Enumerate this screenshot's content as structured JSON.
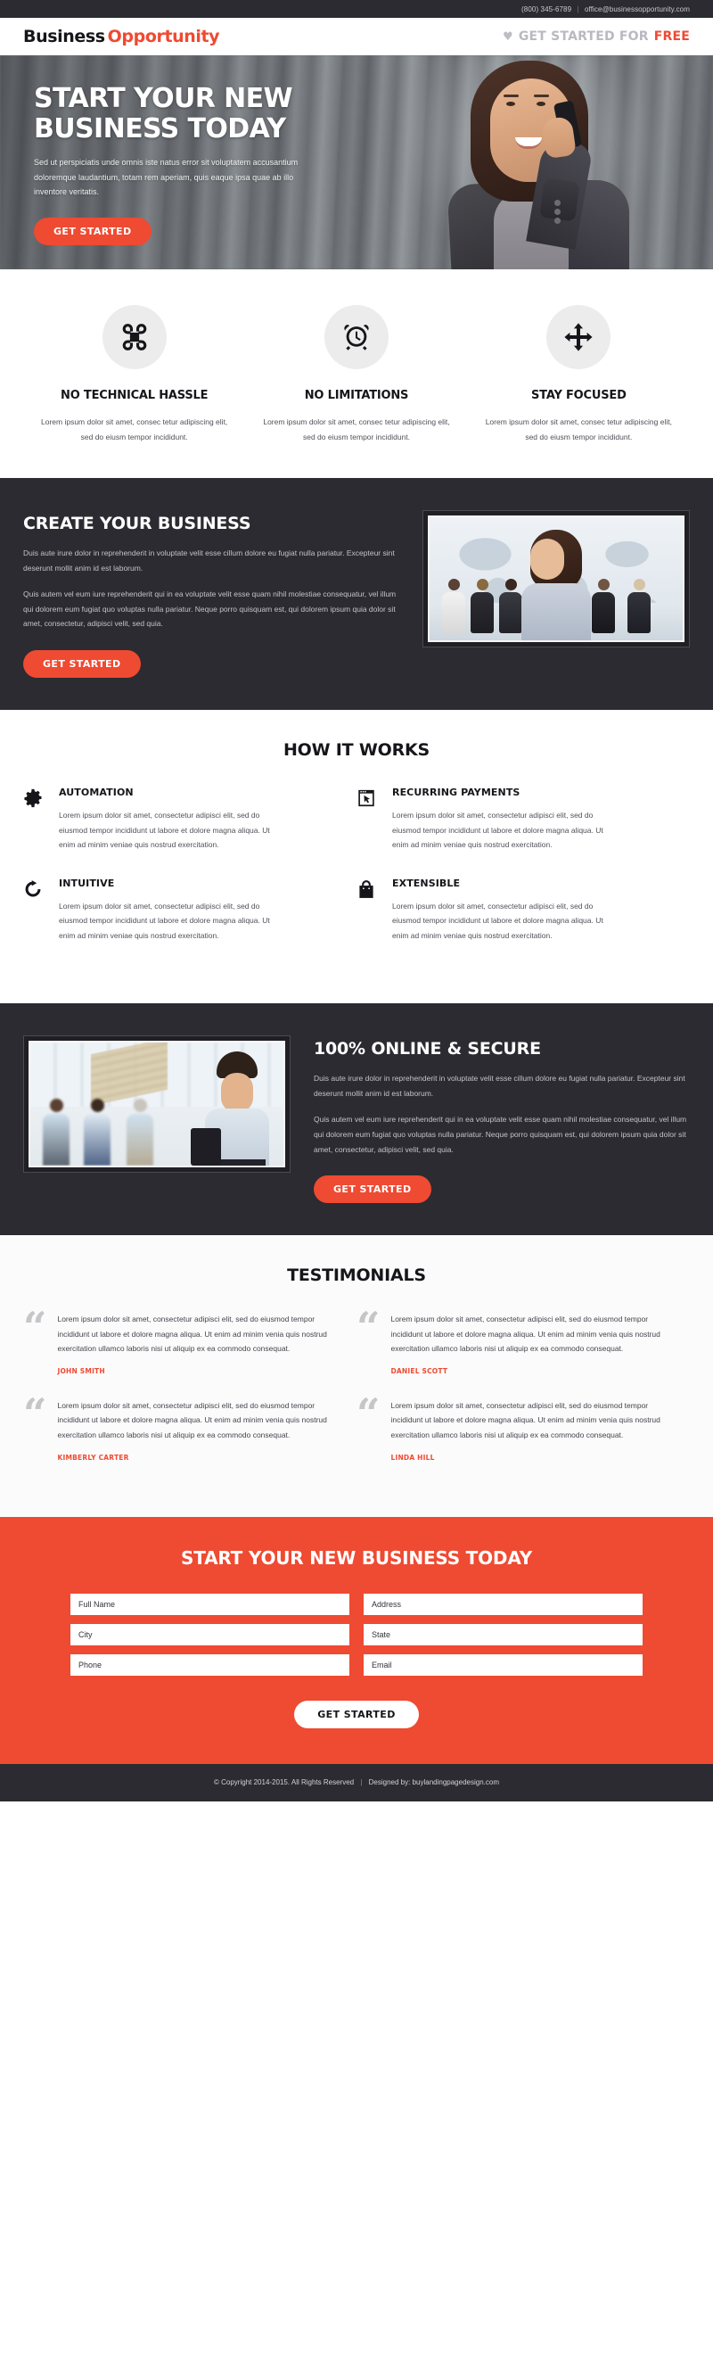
{
  "topbar": {
    "phone": "(800) 345-6789",
    "separator": "|",
    "email": "office@businessopportunity.com"
  },
  "header": {
    "logo_part1": "Business",
    "logo_part2": "Opportunity",
    "heart_icon": "heart-icon",
    "cta_grey": "GET STARTED FOR",
    "cta_accent": "FREE"
  },
  "hero": {
    "title_line1": "START YOUR NEW",
    "title_line2": "BUSINESS TODAY",
    "subtitle": "Sed ut perspiciatis unde omnis iste natus error sit voluptatem accusantium doloremque laudantium, totam rem aperiam, quis eaque ipsa quae ab illo inventore veritatis.",
    "button": "GET STARTED",
    "image_alt": "businesswoman-on-phone-photo"
  },
  "features": [
    {
      "icon": "command-icon",
      "title": "NO TECHNICAL HASSLE",
      "text": "Lorem ipsum dolor sit amet, consec tetur adipiscing elit, sed do eiusm tempor incididunt."
    },
    {
      "icon": "alarm-clock-icon",
      "title": "NO LIMITATIONS",
      "text": "Lorem ipsum dolor sit amet, consec tetur adipiscing elit, sed do eiusm tempor incididunt."
    },
    {
      "icon": "move-arrows-icon",
      "title": "STAY FOCUSED",
      "text": "Lorem ipsum dolor sit amet, consec tetur adipiscing elit, sed do eiusm tempor incididunt."
    }
  ],
  "create_business": {
    "title": "CREATE YOUR BUSINESS",
    "paragraph1": "Duis aute irure dolor in reprehenderit in voluptate velit esse cillum dolore eu fugiat nulla pariatur. Excepteur sint deserunt mollit anim id est laborum.",
    "paragraph2": "Quis autem vel eum iure reprehenderit qui in ea voluptate velit esse quam nihil molestiae consequatur, vel illum qui dolorem eum fugiat quo voluptas nulla pariatur. Neque porro quisquam est, qui dolorem ipsum quia dolor sit amet, consectetur, adipisci velit, sed quia.",
    "button": "GET STARTED",
    "image_alt": "business-team-world-map-photo"
  },
  "how_it_works": {
    "title": "HOW IT WORKS",
    "items": [
      {
        "icon": "gear-icon",
        "title": "AUTOMATION",
        "text": "Lorem ipsum dolor sit amet, consectetur adipisci elit, sed do eiusmod tempor incididunt ut labore et dolore magna aliqua. Ut enim ad minim veniae quis nostrud exercitation."
      },
      {
        "icon": "browser-cursor-icon",
        "title": "RECURRING PAYMENTS",
        "text": "Lorem ipsum dolor sit amet, consectetur adipisci elit, sed do eiusmod tempor incididunt ut labore et dolore magna aliqua. Ut enim ad minim veniae quis nostrud exercitation."
      },
      {
        "icon": "refresh-icon",
        "title": "INTUITIVE",
        "text": "Lorem ipsum dolor sit amet, consectetur adipisci elit, sed do eiusmod tempor incididunt ut labore et dolore magna aliqua. Ut enim ad minim veniae quis nostrud exercitation."
      },
      {
        "icon": "shopping-bag-icon",
        "title": "EXTENSIBLE",
        "text": "Lorem ipsum dolor sit amet, consectetur adipisci elit, sed do eiusmod tempor incididunt ut labore et dolore magna aliqua. Ut enim ad minim veniae quis nostrud exercitation."
      }
    ]
  },
  "online_secure": {
    "title": "100% ONLINE & SECURE",
    "paragraph1": "Duis aute irure dolor in reprehenderit in voluptate velit esse cillum dolore eu fugiat nulla pariatur. Excepteur sint deserunt mollit anim id est laborum.",
    "paragraph2": "Quis autem vel eum iure reprehenderit qui in ea voluptate velit esse quam nihil molestiae consequatur, vel illum qui dolorem eum fugiat quo voluptas nulla pariatur. Neque porro quisquam est, qui dolorem ipsum quia dolor sit amet, consectetur, adipisci velit, sed quia.",
    "button": "GET STARTED",
    "image_alt": "businessman-office-team-photo"
  },
  "testimonials": {
    "title": "TESTIMONIALS",
    "quote_glyph": "“",
    "items": [
      {
        "text": "Lorem ipsum dolor sit amet, consectetur adipisci elit, sed do eiusmod tempor incididunt ut labore et dolore magna aliqua. Ut enim ad minim venia quis nostrud exercitation ullamco laboris nisi ut aliquip ex ea commodo consequat.",
        "name": "JOHN SMITH"
      },
      {
        "text": "Lorem ipsum dolor sit amet, consectetur adipisci elit, sed do eiusmod tempor incididunt ut labore et dolore magna aliqua. Ut enim ad minim venia quis nostrud exercitation ullamco laboris nisi ut aliquip ex ea commodo consequat.",
        "name": "DANIEL SCOTT"
      },
      {
        "text": "Lorem ipsum dolor sit amet, consectetur adipisci elit, sed do eiusmod tempor incididunt ut labore et dolore magna aliqua. Ut enim ad minim venia quis nostrud exercitation ullamco laboris nisi ut aliquip ex ea commodo consequat.",
        "name": "KIMBERLY CARTER"
      },
      {
        "text": "Lorem ipsum dolor sit amet, consectetur adipisci elit, sed do eiusmod tempor incididunt ut labore et dolore magna aliqua. Ut enim ad minim venia quis nostrud exercitation ullamco laboris nisi ut aliquip ex ea commodo consequat.",
        "name": "LINDA HILL"
      }
    ]
  },
  "cta_form": {
    "title": "START YOUR NEW BUSINESS TODAY",
    "fields": [
      {
        "name": "full-name",
        "placeholder": "Full Name",
        "value": ""
      },
      {
        "name": "address",
        "placeholder": "Address",
        "value": ""
      },
      {
        "name": "city",
        "placeholder": "City",
        "value": ""
      },
      {
        "name": "state",
        "placeholder": "State",
        "value": ""
      },
      {
        "name": "phone",
        "placeholder": "Phone",
        "value": ""
      },
      {
        "name": "email",
        "placeholder": "Email",
        "value": ""
      }
    ],
    "button": "GET STARTED"
  },
  "footer": {
    "copyright": "© Copyright 2014-2015. All Rights Reserved",
    "separator": "|",
    "designed_by": "Designed by: buylandingpagedesign.com"
  },
  "colors": {
    "accent": "#ef4a32",
    "dark": "#2b2b31",
    "light_grey": "#ececec"
  }
}
